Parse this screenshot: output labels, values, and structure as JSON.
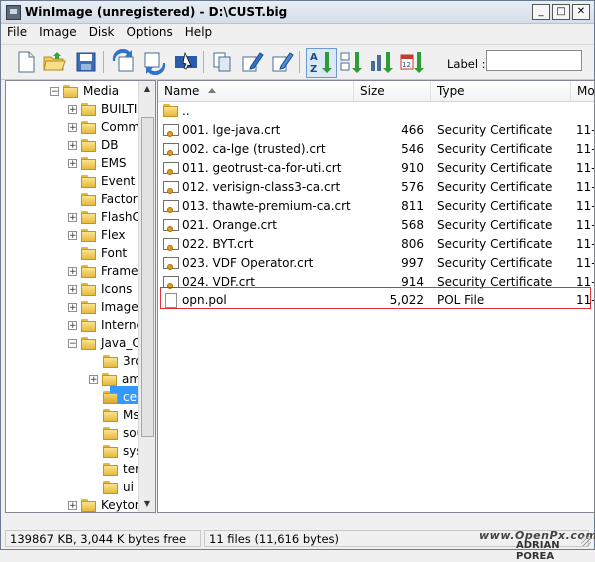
{
  "window": {
    "title": "WinImage (unregistered) - D:\\CUST.big",
    "minimize": "_",
    "maximize": "□",
    "close": "✕"
  },
  "menu": [
    "File",
    "Image",
    "Disk",
    "Options",
    "Help"
  ],
  "toolbar": {
    "label_text": "Label :",
    "label_value": "",
    "icons": [
      "new-icon",
      "open-icon",
      "save-icon",
      "inject-icon",
      "extract-icon",
      "select-icon",
      "sort-name-icon",
      "sort-ext-icon",
      "sort-size-icon",
      "sort-date-icon"
    ]
  },
  "tree": {
    "items": [
      {
        "label": "Media",
        "expander": "−"
      },
      {
        "label": "BUILTIN",
        "expander": "+"
      },
      {
        "label": "Comm",
        "expander": "+"
      },
      {
        "label": "DB",
        "expander": "+"
      },
      {
        "label": "EMS",
        "expander": "+"
      },
      {
        "label": "Event s",
        "expander": ""
      },
      {
        "label": "Factor",
        "expander": ""
      },
      {
        "label": "FlashC",
        "expander": "+"
      },
      {
        "label": "Flex",
        "expander": "+"
      },
      {
        "label": "Font",
        "expander": ""
      },
      {
        "label": "Frame",
        "expander": "+"
      },
      {
        "label": "Icons",
        "expander": "+"
      },
      {
        "label": "Image",
        "expander": "+"
      },
      {
        "label": "Interne",
        "expander": "+"
      },
      {
        "label": "Java_O",
        "expander": "−"
      },
      {
        "label": "3rd",
        "expander": ""
      },
      {
        "label": "am",
        "expander": "+"
      },
      {
        "label": "cer",
        "expander": ""
      },
      {
        "label": "Ms",
        "expander": ""
      },
      {
        "label": "sou",
        "expander": ""
      },
      {
        "label": "sys",
        "expander": ""
      },
      {
        "label": "ter",
        "expander": ""
      },
      {
        "label": "ui",
        "expander": ""
      },
      {
        "label": "Keytor",
        "expander": "+"
      }
    ]
  },
  "list": {
    "columns": {
      "name": "Name",
      "size": "Size",
      "type": "Type",
      "modified": "Mo"
    },
    "rows": [
      {
        "name": "..",
        "size": "",
        "type": "",
        "mod": "",
        "icon": "folder"
      },
      {
        "name": "001. lge-java.crt",
        "size": "466",
        "type": "Security Certificate",
        "mod": "11-",
        "icon": "certificate"
      },
      {
        "name": "002. ca-lge (trusted).crt",
        "size": "546",
        "type": "Security Certificate",
        "mod": "11-",
        "icon": "certificate"
      },
      {
        "name": "011. geotrust-ca-for-uti.crt",
        "size": "910",
        "type": "Security Certificate",
        "mod": "11-",
        "icon": "certificate"
      },
      {
        "name": "012. verisign-class3-ca.crt",
        "size": "576",
        "type": "Security Certificate",
        "mod": "11-",
        "icon": "certificate"
      },
      {
        "name": "013. thawte-premium-ca.crt",
        "size": "811",
        "type": "Security Certificate",
        "mod": "11-",
        "icon": "certificate"
      },
      {
        "name": "021. Orange.crt",
        "size": "568",
        "type": "Security Certificate",
        "mod": "11-",
        "icon": "certificate"
      },
      {
        "name": "022. BYT.crt",
        "size": "806",
        "type": "Security Certificate",
        "mod": "11-",
        "icon": "certificate"
      },
      {
        "name": "023. VDF Operator.crt",
        "size": "997",
        "type": "Security Certificate",
        "mod": "11-",
        "icon": "certificate"
      },
      {
        "name": "024. VDF.crt",
        "size": "914",
        "type": "Security Certificate",
        "mod": "11-",
        "icon": "certificate"
      },
      {
        "name": "opn.pol",
        "size": "5,022",
        "type": "POL File",
        "mod": "11-",
        "icon": "document"
      }
    ]
  },
  "status": {
    "left": "139867 KB, 3,044 K bytes free",
    "right": "11 files (11,616 bytes)"
  },
  "watermark": {
    "line1": "www.OpenPx.com",
    "line2": "ADRIAN POREA"
  },
  "colors": {
    "selection": "#3399ff",
    "highlight_border": "#e0303a",
    "folder": "#e7b93e"
  }
}
